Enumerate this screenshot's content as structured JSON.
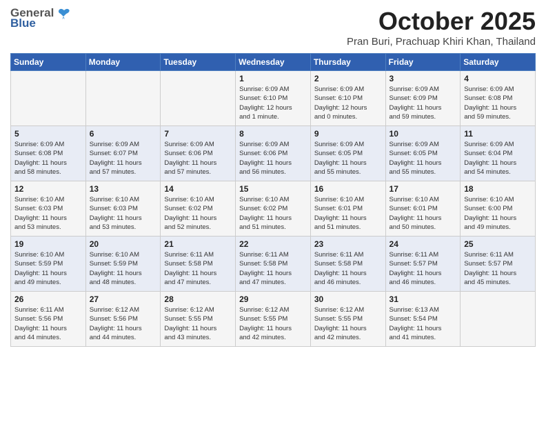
{
  "logo": {
    "general": "General",
    "blue": "Blue"
  },
  "header": {
    "month": "October 2025",
    "location": "Pran Buri, Prachuap Khiri Khan, Thailand"
  },
  "weekdays": [
    "Sunday",
    "Monday",
    "Tuesday",
    "Wednesday",
    "Thursday",
    "Friday",
    "Saturday"
  ],
  "weeks": [
    [
      {
        "day": "",
        "detail": ""
      },
      {
        "day": "",
        "detail": ""
      },
      {
        "day": "",
        "detail": ""
      },
      {
        "day": "1",
        "detail": "Sunrise: 6:09 AM\nSunset: 6:10 PM\nDaylight: 12 hours\nand 1 minute."
      },
      {
        "day": "2",
        "detail": "Sunrise: 6:09 AM\nSunset: 6:10 PM\nDaylight: 12 hours\nand 0 minutes."
      },
      {
        "day": "3",
        "detail": "Sunrise: 6:09 AM\nSunset: 6:09 PM\nDaylight: 11 hours\nand 59 minutes."
      },
      {
        "day": "4",
        "detail": "Sunrise: 6:09 AM\nSunset: 6:08 PM\nDaylight: 11 hours\nand 59 minutes."
      }
    ],
    [
      {
        "day": "5",
        "detail": "Sunrise: 6:09 AM\nSunset: 6:08 PM\nDaylight: 11 hours\nand 58 minutes."
      },
      {
        "day": "6",
        "detail": "Sunrise: 6:09 AM\nSunset: 6:07 PM\nDaylight: 11 hours\nand 57 minutes."
      },
      {
        "day": "7",
        "detail": "Sunrise: 6:09 AM\nSunset: 6:06 PM\nDaylight: 11 hours\nand 57 minutes."
      },
      {
        "day": "8",
        "detail": "Sunrise: 6:09 AM\nSunset: 6:06 PM\nDaylight: 11 hours\nand 56 minutes."
      },
      {
        "day": "9",
        "detail": "Sunrise: 6:09 AM\nSunset: 6:05 PM\nDaylight: 11 hours\nand 55 minutes."
      },
      {
        "day": "10",
        "detail": "Sunrise: 6:09 AM\nSunset: 6:05 PM\nDaylight: 11 hours\nand 55 minutes."
      },
      {
        "day": "11",
        "detail": "Sunrise: 6:09 AM\nSunset: 6:04 PM\nDaylight: 11 hours\nand 54 minutes."
      }
    ],
    [
      {
        "day": "12",
        "detail": "Sunrise: 6:10 AM\nSunset: 6:03 PM\nDaylight: 11 hours\nand 53 minutes."
      },
      {
        "day": "13",
        "detail": "Sunrise: 6:10 AM\nSunset: 6:03 PM\nDaylight: 11 hours\nand 53 minutes."
      },
      {
        "day": "14",
        "detail": "Sunrise: 6:10 AM\nSunset: 6:02 PM\nDaylight: 11 hours\nand 52 minutes."
      },
      {
        "day": "15",
        "detail": "Sunrise: 6:10 AM\nSunset: 6:02 PM\nDaylight: 11 hours\nand 51 minutes."
      },
      {
        "day": "16",
        "detail": "Sunrise: 6:10 AM\nSunset: 6:01 PM\nDaylight: 11 hours\nand 51 minutes."
      },
      {
        "day": "17",
        "detail": "Sunrise: 6:10 AM\nSunset: 6:01 PM\nDaylight: 11 hours\nand 50 minutes."
      },
      {
        "day": "18",
        "detail": "Sunrise: 6:10 AM\nSunset: 6:00 PM\nDaylight: 11 hours\nand 49 minutes."
      }
    ],
    [
      {
        "day": "19",
        "detail": "Sunrise: 6:10 AM\nSunset: 5:59 PM\nDaylight: 11 hours\nand 49 minutes."
      },
      {
        "day": "20",
        "detail": "Sunrise: 6:10 AM\nSunset: 5:59 PM\nDaylight: 11 hours\nand 48 minutes."
      },
      {
        "day": "21",
        "detail": "Sunrise: 6:11 AM\nSunset: 5:58 PM\nDaylight: 11 hours\nand 47 minutes."
      },
      {
        "day": "22",
        "detail": "Sunrise: 6:11 AM\nSunset: 5:58 PM\nDaylight: 11 hours\nand 47 minutes."
      },
      {
        "day": "23",
        "detail": "Sunrise: 6:11 AM\nSunset: 5:58 PM\nDaylight: 11 hours\nand 46 minutes."
      },
      {
        "day": "24",
        "detail": "Sunrise: 6:11 AM\nSunset: 5:57 PM\nDaylight: 11 hours\nand 46 minutes."
      },
      {
        "day": "25",
        "detail": "Sunrise: 6:11 AM\nSunset: 5:57 PM\nDaylight: 11 hours\nand 45 minutes."
      }
    ],
    [
      {
        "day": "26",
        "detail": "Sunrise: 6:11 AM\nSunset: 5:56 PM\nDaylight: 11 hours\nand 44 minutes."
      },
      {
        "day": "27",
        "detail": "Sunrise: 6:12 AM\nSunset: 5:56 PM\nDaylight: 11 hours\nand 44 minutes."
      },
      {
        "day": "28",
        "detail": "Sunrise: 6:12 AM\nSunset: 5:55 PM\nDaylight: 11 hours\nand 43 minutes."
      },
      {
        "day": "29",
        "detail": "Sunrise: 6:12 AM\nSunset: 5:55 PM\nDaylight: 11 hours\nand 42 minutes."
      },
      {
        "day": "30",
        "detail": "Sunrise: 6:12 AM\nSunset: 5:55 PM\nDaylight: 11 hours\nand 42 minutes."
      },
      {
        "day": "31",
        "detail": "Sunrise: 6:13 AM\nSunset: 5:54 PM\nDaylight: 11 hours\nand 41 minutes."
      },
      {
        "day": "",
        "detail": ""
      }
    ]
  ]
}
